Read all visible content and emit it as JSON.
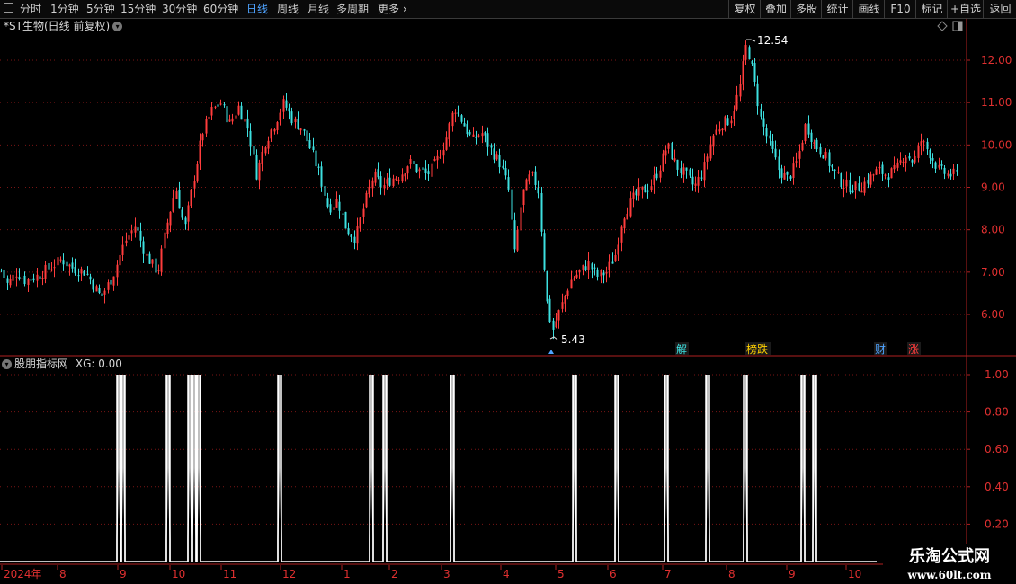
{
  "toolbar": {
    "periods": [
      "分时",
      "1分钟",
      "5分钟",
      "15分钟",
      "30分钟",
      "60分钟",
      "日线",
      "周线",
      "月线",
      "多周期",
      "更多"
    ],
    "active_period": "日线",
    "right_buttons": [
      "复权",
      "叠加",
      "多股",
      "统计",
      "画线",
      "F10",
      "标记",
      "+自选",
      "返回"
    ]
  },
  "chart_title": "*ST生物(日线 前复权)",
  "indicator_title": "股朋指标网",
  "indicator_value": "XG: 0.00",
  "watermark": {
    "line1": "乐淘公式网",
    "line2": "www.60lt.com"
  },
  "colors": {
    "up": "#ff3c3c",
    "down": "#3de0e0",
    "grid": "#7a1515",
    "axis": "#b02020",
    "signal": "#ffffff",
    "active": "#4fa3ff"
  },
  "chart_data": [
    {
      "type": "candlestick",
      "ylim": [
        5.2,
        12.8
      ],
      "yticks": [
        "6.00",
        "7.00",
        "8.00",
        "9.00",
        "10.00",
        "11.00",
        "12.00"
      ],
      "annotations": [
        {
          "label": "12.54",
          "kind": "high"
        },
        {
          "label": "5.43",
          "kind": "low"
        }
      ],
      "event_markers": [
        {
          "text": "解",
          "color": "#3de0e0"
        },
        {
          "text": "榜跌",
          "color": "#ffd000"
        },
        {
          "text": "财",
          "color": "#4fa3ff"
        },
        {
          "text": "涨",
          "color": "#ff3c3c"
        }
      ],
      "close_path": [
        [
          0,
          7.1
        ],
        [
          8,
          6.7
        ],
        [
          18,
          7.0
        ],
        [
          28,
          6.8
        ],
        [
          40,
          6.9
        ],
        [
          55,
          7.1
        ],
        [
          68,
          7.3
        ],
        [
          80,
          7.1
        ],
        [
          95,
          7.0
        ],
        [
          112,
          6.4
        ],
        [
          125,
          6.9
        ],
        [
          138,
          7.7
        ],
        [
          150,
          8.1
        ],
        [
          162,
          7.4
        ],
        [
          175,
          7.0
        ],
        [
          185,
          8.1
        ],
        [
          195,
          9.0
        ],
        [
          205,
          8.0
        ],
        [
          215,
          9.2
        ],
        [
          225,
          10.3
        ],
        [
          235,
          10.8
        ],
        [
          245,
          11.0
        ],
        [
          255,
          10.5
        ],
        [
          265,
          10.9
        ],
        [
          275,
          10.4
        ],
        [
          285,
          9.3
        ],
        [
          295,
          10.1
        ],
        [
          305,
          10.5
        ],
        [
          315,
          11.0
        ],
        [
          325,
          10.6
        ],
        [
          335,
          10.4
        ],
        [
          345,
          9.9
        ],
        [
          355,
          9.3
        ],
        [
          365,
          8.5
        ],
        [
          375,
          8.7
        ],
        [
          385,
          8.0
        ],
        [
          395,
          7.8
        ],
        [
          405,
          8.6
        ],
        [
          415,
          9.3
        ],
        [
          425,
          9.0
        ],
        [
          435,
          9.2
        ],
        [
          445,
          9.3
        ],
        [
          455,
          9.6
        ],
        [
          465,
          9.4
        ],
        [
          475,
          9.3
        ],
        [
          485,
          9.6
        ],
        [
          495,
          10.1
        ],
        [
          505,
          10.9
        ],
        [
          515,
          10.5
        ],
        [
          525,
          10.1
        ],
        [
          535,
          10.3
        ],
        [
          545,
          9.9
        ],
        [
          555,
          9.6
        ],
        [
          565,
          9.0
        ],
        [
          572,
          7.4
        ],
        [
          580,
          8.8
        ],
        [
          590,
          9.3
        ],
        [
          598,
          9.0
        ],
        [
          608,
          6.3
        ],
        [
          614,
          5.6
        ],
        [
          624,
          6.2
        ],
        [
          634,
          6.8
        ],
        [
          644,
          7.0
        ],
        [
          654,
          7.2
        ],
        [
          664,
          6.9
        ],
        [
          674,
          7.0
        ],
        [
          684,
          7.4
        ],
        [
          692,
          8.3
        ],
        [
          702,
          8.7
        ],
        [
          712,
          8.9
        ],
        [
          722,
          9.0
        ],
        [
          732,
          9.4
        ],
        [
          742,
          10.0
        ],
        [
          752,
          9.5
        ],
        [
          762,
          9.3
        ],
        [
          772,
          9.0
        ],
        [
          782,
          9.4
        ],
        [
          792,
          10.2
        ],
        [
          802,
          10.5
        ],
        [
          812,
          10.6
        ],
        [
          822,
          11.3
        ],
        [
          830,
          12.4
        ],
        [
          836,
          11.8
        ],
        [
          846,
          10.6
        ],
        [
          856,
          10.0
        ],
        [
          866,
          9.4
        ],
        [
          876,
          9.2
        ],
        [
          886,
          9.6
        ],
        [
          896,
          10.5
        ],
        [
          906,
          10.0
        ],
        [
          916,
          9.8
        ],
        [
          926,
          9.4
        ],
        [
          936,
          9.1
        ],
        [
          946,
          9.0
        ],
        [
          956,
          9.0
        ],
        [
          966,
          9.2
        ],
        [
          976,
          9.4
        ],
        [
          986,
          9.3
        ],
        [
          996,
          9.4
        ],
        [
          1006,
          9.8
        ],
        [
          1016,
          9.6
        ],
        [
          1024,
          10.1
        ],
        [
          1034,
          9.8
        ],
        [
          1044,
          9.4
        ],
        [
          1054,
          9.3
        ],
        [
          1064,
          9.3
        ]
      ]
    },
    {
      "type": "line",
      "name": "XG",
      "ylim": [
        0,
        1.08
      ],
      "yticks": [
        "0.20",
        "0.40",
        "0.60",
        "0.80",
        "1.00"
      ],
      "signal_x": [
        132,
        137,
        187,
        211,
        216,
        221,
        311,
        413,
        428,
        503,
        639,
        686,
        741,
        787,
        829,
        893,
        906
      ]
    },
    {
      "type": "axis",
      "x_labels": [
        {
          "label": "2024年",
          "pos": 2
        },
        {
          "label": "8",
          "pos": 64
        },
        {
          "label": "9",
          "pos": 131
        },
        {
          "label": "10",
          "pos": 189
        },
        {
          "label": "11",
          "pos": 246
        },
        {
          "label": "12",
          "pos": 312
        },
        {
          "label": "1",
          "pos": 380
        },
        {
          "label": "2",
          "pos": 433
        },
        {
          "label": "3",
          "pos": 491
        },
        {
          "label": "4",
          "pos": 557
        },
        {
          "label": "5",
          "pos": 618
        },
        {
          "label": "6",
          "pos": 676
        },
        {
          "label": "7",
          "pos": 737
        },
        {
          "label": "8",
          "pos": 808
        },
        {
          "label": "9",
          "pos": 875
        },
        {
          "label": "10",
          "pos": 941
        }
      ]
    }
  ]
}
